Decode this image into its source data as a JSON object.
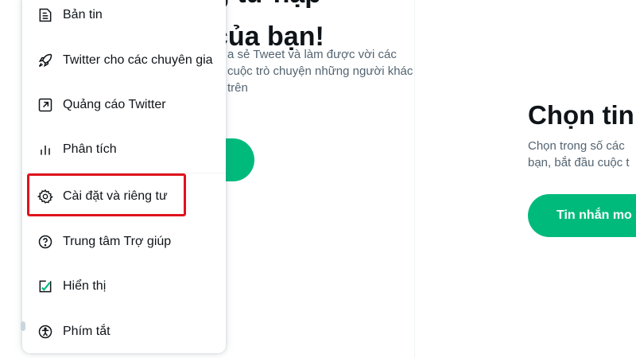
{
  "background": {
    "messages_panel": {
      "heading_line1": "g tư nập",
      "heading_line2": "của bạn!",
      "description": "a sẻ Tweet và làm được vời các cuộc trò chuyện những người khác trên",
      "button_color": "#00ba7c"
    },
    "right_panel": {
      "title": "Chọn tin",
      "description_line1": "Chọn trong số các",
      "description_line2": "bạn, bắt đầu cuộc t",
      "button_label": "Tin nhắn mo",
      "button_color": "#00ba7c"
    }
  },
  "menu": {
    "items": [
      {
        "label": "Bản tin",
        "icon": "newsletter-icon"
      },
      {
        "label": "Twitter cho các chuyên gia",
        "icon": "rocket-icon"
      },
      {
        "label": "Quảng cáo Twitter",
        "icon": "external-arrow-icon"
      },
      {
        "label": "Phân tích",
        "icon": "analytics-icon"
      },
      {
        "label": "Cài đặt và riêng tư",
        "icon": "gear-icon",
        "highlighted": true
      },
      {
        "label": "Trung tâm Trợ giúp",
        "icon": "help-icon"
      },
      {
        "label": "Hiển thị",
        "icon": "display-icon"
      },
      {
        "label": "Phím tắt",
        "icon": "accessibility-icon"
      }
    ]
  },
  "colors": {
    "highlight_border": "#e0131d",
    "text_primary": "#0f1419",
    "text_secondary": "#536471"
  }
}
